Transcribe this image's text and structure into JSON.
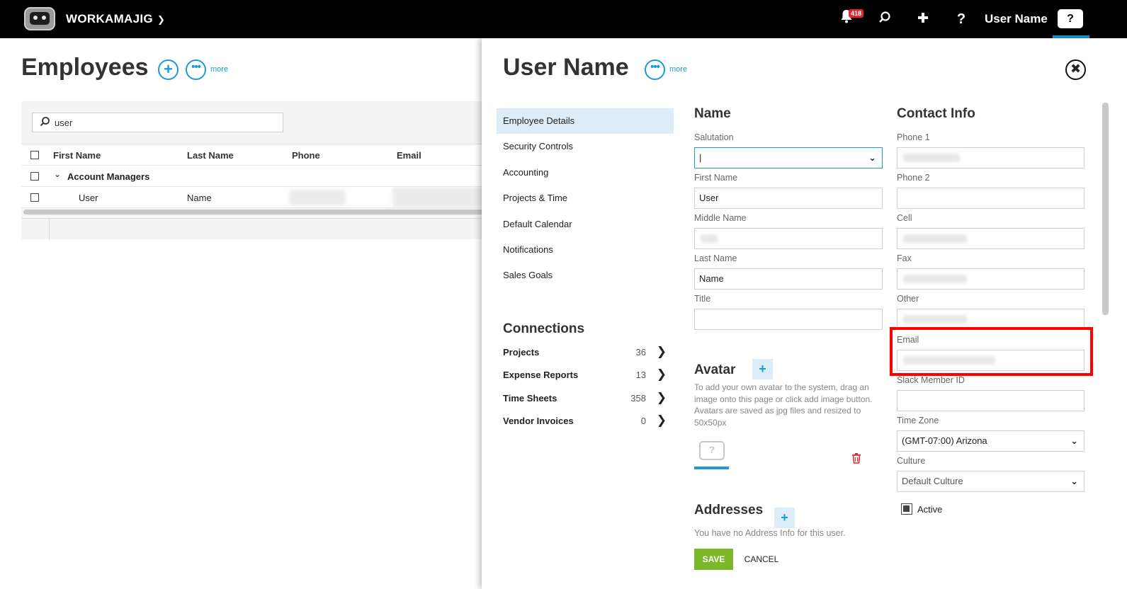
{
  "topbar": {
    "app_name": "WORKAMAJIG",
    "notification_count": "418",
    "user_name": "User Name",
    "icons": [
      "bell-icon",
      "search-icon",
      "plus-icon",
      "help-icon",
      "help-box-icon"
    ]
  },
  "employees": {
    "title": "Employees",
    "more_label": "more",
    "search_value": "user",
    "columns": [
      "First Name",
      "Last Name",
      "Phone",
      "Email"
    ],
    "group_label": "Account Managers",
    "rows": [
      {
        "first_name": "User",
        "last_name": "Name"
      }
    ]
  },
  "drawer": {
    "title": "User Name",
    "more_label": "more",
    "nav": [
      "Employee Details",
      "Security Controls",
      "Accounting",
      "Projects & Time",
      "Default Calendar",
      "Notifications",
      "Sales Goals"
    ],
    "connections_title": "Connections",
    "connections": [
      {
        "label": "Projects",
        "count": "36"
      },
      {
        "label": "Expense Reports",
        "count": "13"
      },
      {
        "label": "Time Sheets",
        "count": "358"
      },
      {
        "label": "Vendor Invoices",
        "count": "0"
      }
    ],
    "name_section": {
      "title": "Name",
      "salutation_label": "Salutation",
      "salutation_value": "|",
      "first_name_label": "First Name",
      "first_name_value": "User",
      "middle_name_label": "Middle Name",
      "last_name_label": "Last Name",
      "last_name_value": "Name",
      "title_label": "Title"
    },
    "avatar": {
      "title": "Avatar",
      "help_text": "To add your own avatar to the system, drag an image onto this page or click add image button. Avatars are saved as jpg files and resized to 50x50px"
    },
    "addresses": {
      "title": "Addresses",
      "empty_text": "You have no Address Info for this user."
    },
    "contact": {
      "title": "Contact Info",
      "phone1_label": "Phone 1",
      "phone2_label": "Phone 2",
      "cell_label": "Cell",
      "fax_label": "Fax",
      "other_label": "Other",
      "email_label": "Email",
      "slack_label": "Slack Member ID",
      "timezone_label": "Time Zone",
      "timezone_value": "(GMT-07:00) Arizona",
      "culture_label": "Culture",
      "culture_value": "Default Culture",
      "active_label": "Active"
    },
    "save_label": "SAVE",
    "cancel_label": "CANCEL"
  },
  "colors": {
    "accent": "#1a9bd7",
    "save": "#7ab829",
    "highlight": "#ff0000",
    "badge": "#e3262e"
  }
}
